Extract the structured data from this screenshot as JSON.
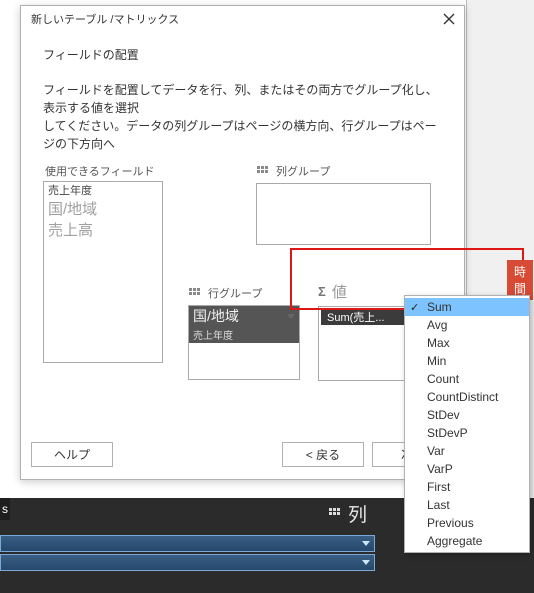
{
  "dialog": {
    "title": "新しいテーブル /マトリックス",
    "heading": "フィールドの配置",
    "description_l1": "フィールドを配置してデータを行、列、またはその両方でグループ化し、表示する値を選択",
    "description_l2": "してください。データの列グループはページの横方向、行グループはページの下方向へ",
    "available_label": "使用できるフィールド",
    "available_items": [
      "売上年度",
      "国/地域",
      "売上高"
    ],
    "col_group_label": "列グループ",
    "row_group_label": "行グループ",
    "row_group_items": [
      "国/地域",
      "売上年度"
    ],
    "value_label": "値",
    "value_item": "Sum(売上...",
    "buttons": {
      "help": "ヘルプ",
      "back": "< 戻る",
      "next": "次へ"
    }
  },
  "context_menu": {
    "selected": "Sum",
    "items": [
      "Sum",
      "Avg",
      "Max",
      "Min",
      "Count",
      "CountDistinct",
      "StDev",
      "StDevP",
      "Var",
      "VarP",
      "First",
      "Last",
      "Previous",
      "Aggregate"
    ]
  },
  "side_chip": "時間",
  "bottom": {
    "tab": "s",
    "col_label": "列"
  }
}
